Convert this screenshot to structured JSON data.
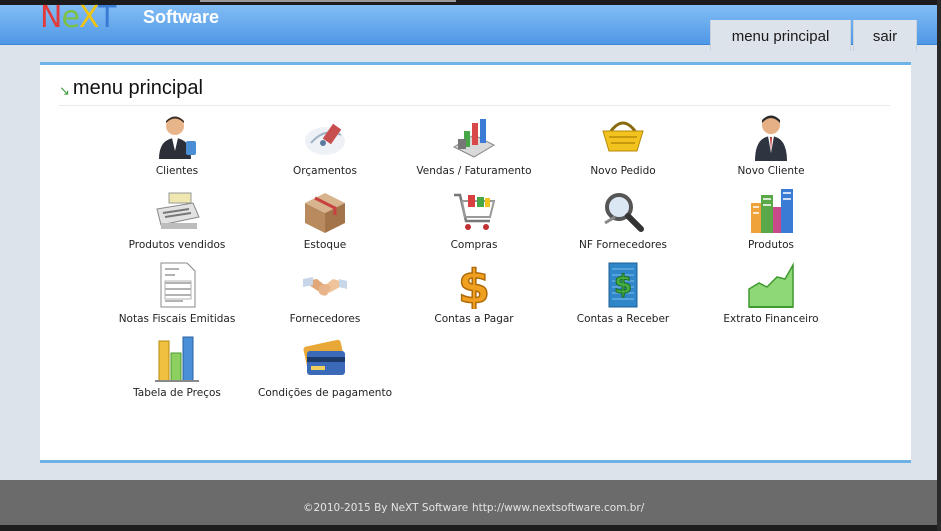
{
  "brand": {
    "logo_letters": [
      "N",
      "e",
      "X",
      "T"
    ],
    "product_word": "Software"
  },
  "nav": {
    "menu_label": "menu principal",
    "exit_label": "sair"
  },
  "panel": {
    "title": "menu principal"
  },
  "items": [
    {
      "label": "Clientes",
      "icon": "client-person-icon"
    },
    {
      "label": "Orçamentos",
      "icon": "quote-document-icon"
    },
    {
      "label": "Vendas / Faturamento",
      "icon": "sales-chart-icon"
    },
    {
      "label": "Novo Pedido",
      "icon": "shopping-basket-icon"
    },
    {
      "label": "Novo Cliente",
      "icon": "new-client-icon"
    },
    {
      "label": "Produtos vendidos",
      "icon": "cash-register-icon"
    },
    {
      "label": "Estoque",
      "icon": "stock-box-icon"
    },
    {
      "label": "Compras",
      "icon": "shopping-cart-icon"
    },
    {
      "label": "NF Fornecedores",
      "icon": "magnifier-icon"
    },
    {
      "label": "Produtos",
      "icon": "buildings-icon"
    },
    {
      "label": "Notas Fiscais Emitidas",
      "icon": "invoice-form-icon"
    },
    {
      "label": "Fornecedores",
      "icon": "handshake-icon"
    },
    {
      "label": "Contas a Pagar",
      "icon": "dollar-sign-icon"
    },
    {
      "label": "Contas a Receber",
      "icon": "dollar-building-icon"
    },
    {
      "label": "Extrato Financeiro",
      "icon": "area-chart-icon"
    },
    {
      "label": "Tabela de Preços",
      "icon": "bar-chart-icon"
    },
    {
      "label": "Condições de pagamento",
      "icon": "credit-cards-icon"
    }
  ],
  "footer": {
    "copyright": "©2010-2015 By NeXT Software",
    "url": "http://www.nextsoftware.com.br/"
  },
  "colors": {
    "header_blue": "#5aa0ea",
    "panel_border": "#6db3e6",
    "footer_gray": "#6b6b6b"
  }
}
